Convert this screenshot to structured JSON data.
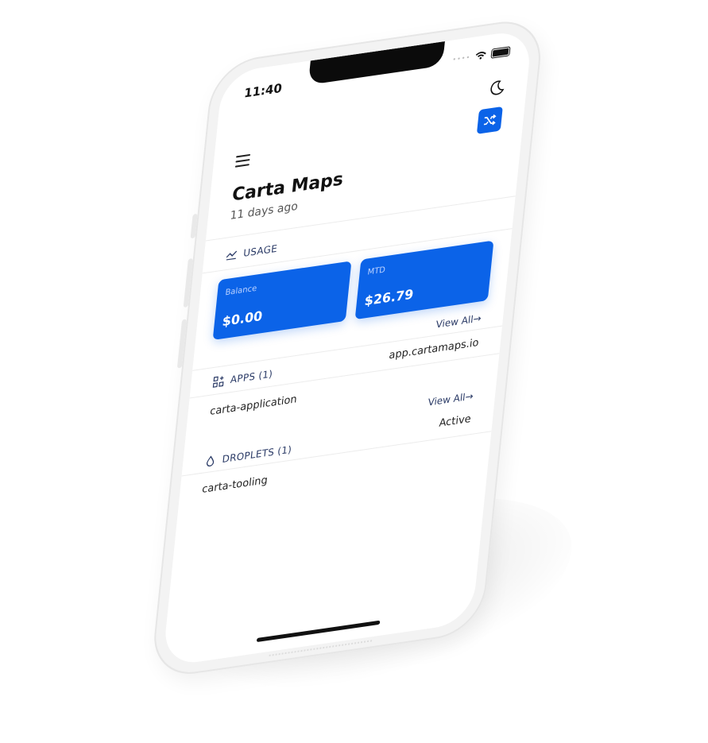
{
  "status_bar": {
    "time": "11:40"
  },
  "header": {
    "title": "Carta Maps",
    "subtitle": "11 days ago"
  },
  "usage": {
    "heading": "USAGE",
    "balance": {
      "label": "Balance",
      "value": "$0.00"
    },
    "mtd": {
      "label": "MTD",
      "value": "$26.79"
    }
  },
  "apps": {
    "view_all": "View All→",
    "heading": "APPS (1)",
    "items": [
      {
        "name": "carta-application",
        "detail": "app.cartamaps.io"
      }
    ]
  },
  "droplets": {
    "view_all": "View All→",
    "heading": "DROPLETS (1)",
    "items": [
      {
        "name": "carta-tooling",
        "status": "Active"
      }
    ]
  },
  "colors": {
    "accent": "#0b63e8",
    "section_text": "#2a3a66"
  }
}
